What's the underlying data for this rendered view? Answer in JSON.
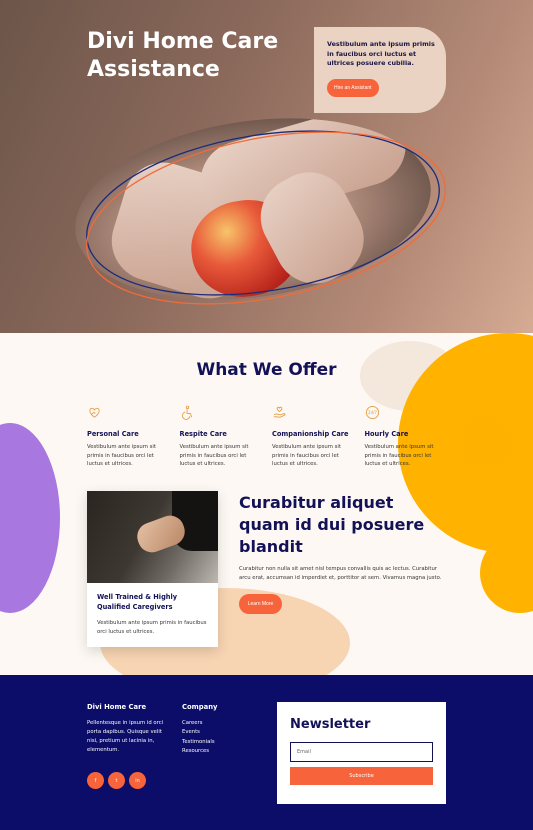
{
  "hero": {
    "title": "Divi Home Care Assistance",
    "card_text": "Vestibulum ante ipsum primis in faucibus orci luctus et ultrices posuere cubilia.",
    "cta": "Hire an Assistant"
  },
  "offer": {
    "title": "What We Offer",
    "services": [
      {
        "icon": "heart-hand-icon",
        "title": "Personal Care",
        "text": "Vestibulum ante ipsum sit primis in faucibus orci let luctus et ultrices."
      },
      {
        "icon": "wheelchair-icon",
        "title": "Respite Care",
        "text": "Vestibulum ante ipsum sit primis in faucibus orci let luctus et ultrices."
      },
      {
        "icon": "caring-hand-icon",
        "title": "Companionship Care",
        "text": "Vestibulum ante ipsum sit primis in faucibus orci let luctus et ultrices."
      },
      {
        "icon": "clock-24-7-icon",
        "title": "Hourly Care",
        "text": "Vestibulum ante ipsum sit primis in faucibus orci let luctus et ultrices."
      }
    ],
    "card": {
      "title": "Well Trained & Highly Qualified Caregivers",
      "text": "Vestibulum ante ipsum primis in faucibus orci luctus et ultrices."
    },
    "side": {
      "title": "Curabitur aliquet quam id dui posuere blandit",
      "text": "Curabitur non nulla sit amet nisl tempus convallis quis ac lectus. Curabitur arcu erat, accumsan id imperdiet et, porttitor at sem. Vivamus magna justo.",
      "cta": "Learn More"
    }
  },
  "footer": {
    "brand_title": "Divi Home Care",
    "brand_text": "Pellentesque in ipsum id orci porta dapibus. Quisque velit nisi, pretium ut lacinia in, elementum.",
    "company_title": "Company",
    "links": [
      "Careers",
      "Events",
      "Testimonials",
      "Resources"
    ],
    "socials": [
      "f",
      "t",
      "in"
    ],
    "newsletter": {
      "title": "Newsletter",
      "placeholder": "Email",
      "button": "Subscribe"
    }
  },
  "colors": {
    "accent": "#f7633a",
    "navy": "#0b0d68",
    "heading": "#131257",
    "yellow": "#ffb300",
    "purple": "#a877e0"
  }
}
